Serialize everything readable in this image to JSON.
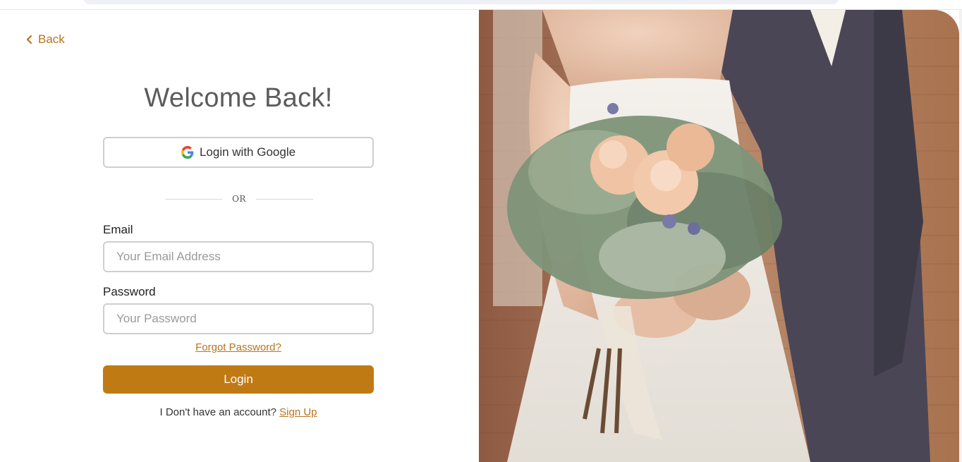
{
  "nav": {
    "back_label": "Back"
  },
  "login": {
    "title": "Welcome Back!",
    "google_label": "Login with Google",
    "divider_text": "OR",
    "email_label": "Email",
    "email_placeholder": "Your Email Address",
    "email_value": "",
    "password_label": "Password",
    "password_placeholder": "Your Password",
    "password_value": "",
    "forgot_label": "Forgot Password?",
    "submit_label": "Login",
    "signup_prompt": "I Don't have an account?",
    "signup_link": "Sign Up"
  },
  "colors": {
    "accent": "#c07a14",
    "link": "#b8741a",
    "title": "#5c5c5c",
    "border": "#cfcfcf"
  },
  "icons": {
    "back": "chevron-left-icon",
    "google": "google-logo-icon"
  }
}
